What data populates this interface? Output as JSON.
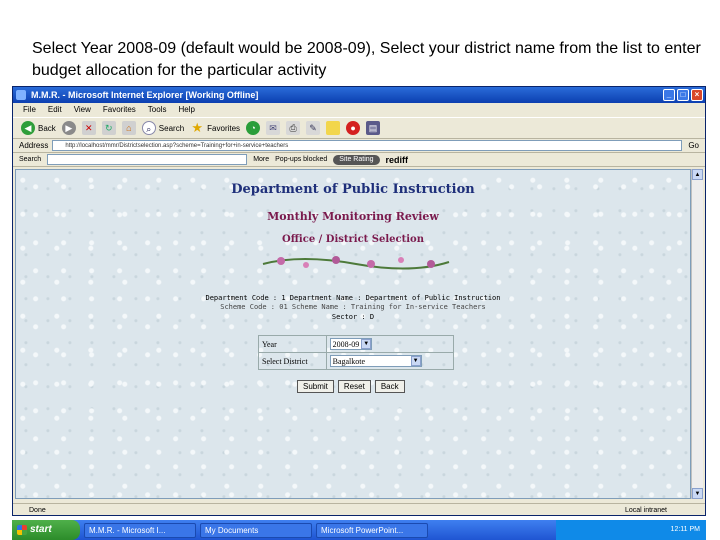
{
  "caption": "Select Year 2008-09 (default would be 2008-09), Select your district name from the list to enter budget allocation for the particular activity",
  "window": {
    "title": "M.M.R. - Microsoft Internet Explorer   [Working Offline]",
    "controls": [
      "_",
      "□",
      "×"
    ]
  },
  "menu": [
    "File",
    "Edit",
    "View",
    "Favorites",
    "Tools",
    "Help"
  ],
  "toolbar": {
    "back": "Back",
    "search": "Search",
    "favorites": "Favorites"
  },
  "address": {
    "label": "Address",
    "url": "http://localhost/mmr/Districtselection.asp?scheme=Training+for+in-service+teachers",
    "go": "Go"
  },
  "searchbar": {
    "label": "Search",
    "more": "More",
    "popups": "Pop-ups blocked",
    "rating": "Site Rating",
    "brand": "rediff"
  },
  "page": {
    "heading": "Department of Public Instruction",
    "subheading": "Monthly Monitoring Review",
    "section": "Office / District Selection",
    "info_line1": "Department Code : 1   Department Name : Department of Public Instruction",
    "info_line2": "Scheme Code : 01   Scheme Name : Training for In-service Teachers",
    "info_line3": "Sector :  D",
    "form": {
      "year_label": "Year",
      "year_value": "2008-09",
      "district_label": "Select District",
      "district_value": "Bagalkote"
    },
    "buttons": {
      "submit": "Submit",
      "reset": "Reset",
      "back": "Back"
    }
  },
  "status": {
    "left": "Done",
    "right": "Local intranet"
  },
  "taskbar": {
    "start": "start",
    "tasks": [
      "M.M.R. - Microsoft I...",
      "My Documents",
      "Microsoft PowerPoint..."
    ],
    "tray_time": "12:11 PM"
  }
}
